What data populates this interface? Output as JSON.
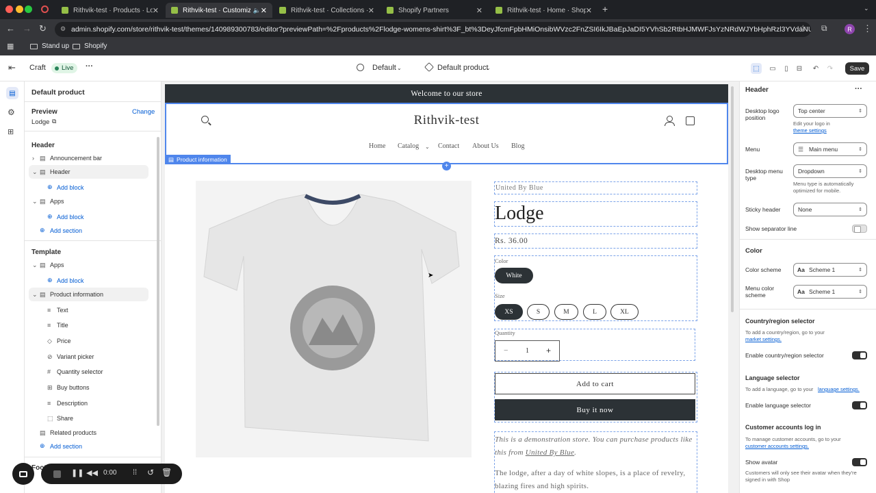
{
  "browser": {
    "tabs": [
      {
        "title": "Rithvik-test · Products · Lodg"
      },
      {
        "title": "Rithvik-test · Customize C"
      },
      {
        "title": "Rithvik-test · Collections · Sh"
      },
      {
        "title": "Shopify Partners"
      },
      {
        "title": "Rithvik-test · Home · Shopify"
      }
    ],
    "url": "admin.shopify.com/store/rithvik-test/themes/140989300783/editor?previewPath=%2Fproducts%2Flodge-womens-shirt%3F_bt%3DeyJfcmFpbHMiOnsibWVzc2FnZSI6IkJBaEpJaDI5YVhSb2RtbHJMWFJsYzNRdWJYbHphRzl3YVdaNUxtTnZi...",
    "profile_initial": "R",
    "bookmarks": [
      "Stand up",
      "Shopify"
    ]
  },
  "topbar": {
    "theme_name": "Craft",
    "status": "Live",
    "more": "···",
    "template_selector": "Default",
    "page_selector": "Default product",
    "save_label": "Save"
  },
  "left_panel": {
    "title": "Default product",
    "preview_label": "Preview",
    "change_label": "Change",
    "preview_product": "Lodge",
    "header_group": "Header",
    "header_items": [
      "Announcement bar",
      "Header"
    ],
    "add_block": "Add block",
    "apps_label": "Apps",
    "add_section": "Add section",
    "template_group": "Template",
    "product_information": "Product information",
    "product_blocks": [
      "Text",
      "Title",
      "Price",
      "Variant picker",
      "Quantity selector",
      "Buy buttons",
      "Description",
      "Share"
    ],
    "related_products": "Related products",
    "footer_partial": "Foot"
  },
  "preview": {
    "announcement": "Welcome to our store",
    "logo": "Rithvik-test",
    "nav": [
      "Home",
      "Catalog",
      "Contact",
      "About Us",
      "Blog"
    ],
    "section_tag": "Product information",
    "vendor": "United By Blue",
    "title": "Lodge",
    "price": "Rs. 36.00",
    "color_label": "Color",
    "color_value": "White",
    "size_label": "Size",
    "sizes": [
      "XS",
      "S",
      "M",
      "L",
      "XL"
    ],
    "quantity_label": "Quantity",
    "quantity_value": "1",
    "add_to_cart": "Add to cart",
    "buy_now": "Buy it now",
    "desc_1a": "This is a demonstration store. You can purchase products like this from ",
    "desc_1_link": "United By Blue",
    "desc_1b": ".",
    "desc_2": "The lodge, after a day of white slopes, is a place of revelry, blazing fires and high spirits."
  },
  "right_panel": {
    "title": "Header",
    "logo_position_label": "Desktop logo position",
    "logo_position_value": "Top center",
    "logo_help": "Edit your logo in",
    "logo_help_link": "theme settings",
    "menu_label": "Menu",
    "menu_value": "Main menu",
    "desktop_menu_type_label": "Desktop menu type",
    "desktop_menu_type_value": "Dropdown",
    "menu_type_help": "Menu type is automatically optimized for mobile.",
    "sticky_header_label": "Sticky header",
    "sticky_header_value": "None",
    "separator_label": "Show separator line",
    "color_heading": "Color",
    "color_scheme_label": "Color scheme",
    "color_scheme_value": "Scheme 1",
    "menu_color_scheme_label": "Menu color scheme",
    "menu_color_scheme_value": "Scheme 1",
    "country_heading": "Country/region selector",
    "country_help": "To add a country/region, go to your",
    "country_help_link": "market settings.",
    "country_enable": "Enable country/region selector",
    "language_heading": "Language selector",
    "language_help": "To add a language, go to your",
    "language_help_link": "language settings.",
    "language_enable": "Enable language selector",
    "accounts_heading": "Customer accounts log in",
    "accounts_help": "To manage customer accounts, go to your",
    "accounts_help_link": "customer accounts settings.",
    "avatar_label": "Show avatar",
    "avatar_help": "Customers will only see their avatar when they're signed in with Shop"
  },
  "recorder": {
    "time": "0:00"
  }
}
